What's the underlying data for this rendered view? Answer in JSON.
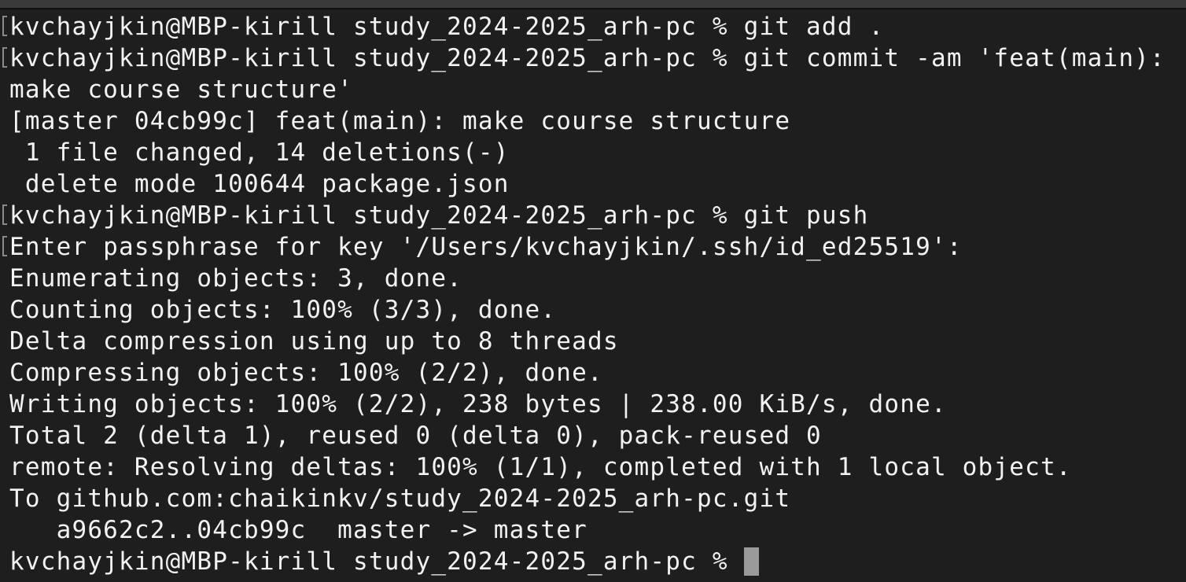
{
  "terminal": {
    "lines": [
      {
        "text": "kvchayjkin@MBP-kirill study_2024-2025_arh-pc % git add .",
        "marked": true
      },
      {
        "text": "kvchayjkin@MBP-kirill study_2024-2025_arh-pc % git commit -am 'feat(main):",
        "marked": true
      },
      {
        "text": "make course structure'",
        "marked": false
      },
      {
        "text": "[master 04cb99c] feat(main): make course structure",
        "marked": false
      },
      {
        "text": " 1 file changed, 14 deletions(-)",
        "marked": false
      },
      {
        "text": " delete mode 100644 package.json",
        "marked": false
      },
      {
        "text": "kvchayjkin@MBP-kirill study_2024-2025_arh-pc % git push",
        "marked": true
      },
      {
        "text": "Enter passphrase for key '/Users/kvchayjkin/.ssh/id_ed25519':",
        "marked": true
      },
      {
        "text": "Enumerating objects: 3, done.",
        "marked": false
      },
      {
        "text": "Counting objects: 100% (3/3), done.",
        "marked": false
      },
      {
        "text": "Delta compression using up to 8 threads",
        "marked": false
      },
      {
        "text": "Compressing objects: 100% (2/2), done.",
        "marked": false
      },
      {
        "text": "Writing objects: 100% (2/2), 238 bytes | 238.00 KiB/s, done.",
        "marked": false
      },
      {
        "text": "Total 2 (delta 1), reused 0 (delta 0), pack-reused 0",
        "marked": false
      },
      {
        "text": "remote: Resolving deltas: 100% (1/1), completed with 1 local object.",
        "marked": false
      },
      {
        "text": "To github.com:chaikinkv/study_2024-2025_arh-pc.git",
        "marked": false
      },
      {
        "text": "   a9662c2..04cb99c  master -> master",
        "marked": false
      }
    ],
    "prompt": "kvchayjkin@MBP-kirill study_2024-2025_arh-pc % "
  },
  "colors": {
    "background": "#1e1e1e",
    "foreground": "#f2f2f2",
    "cursor": "#9a9a9a"
  }
}
